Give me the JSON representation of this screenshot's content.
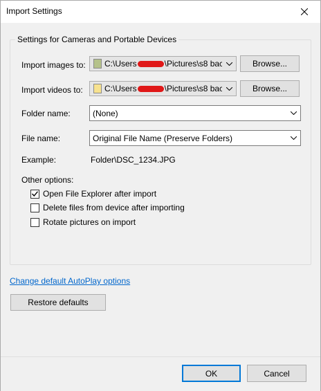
{
  "window": {
    "title": "Import Settings"
  },
  "group": {
    "legend": "Settings for Cameras and Portable Devices"
  },
  "import_images": {
    "label": "Import images to:",
    "path_prefix": "C:\\Users",
    "path_suffix": "\\Pictures\\s8 bac",
    "browse_label": "Browse...",
    "folder_color": "#b5c28a"
  },
  "import_videos": {
    "label": "Import videos to:",
    "path_prefix": "C:\\Users",
    "path_suffix": "\\Pictures\\s8 bac",
    "browse_label": "Browse...",
    "folder_color": "#f7e28f"
  },
  "folder_name": {
    "label": "Folder name:",
    "value": "(None)"
  },
  "file_name": {
    "label": "File name:",
    "value": "Original File Name (Preserve Folders)"
  },
  "example": {
    "label": "Example:",
    "value": "Folder\\DSC_1234.JPG"
  },
  "other_options": {
    "label": "Other options:",
    "items": [
      {
        "label": "Open File Explorer after import",
        "checked": true
      },
      {
        "label": "Delete files from device after importing",
        "checked": false
      },
      {
        "label": "Rotate pictures on import",
        "checked": false
      }
    ]
  },
  "autoplay_link": "Change default AutoPlay options",
  "restore_label": "Restore defaults",
  "ok_label": "OK",
  "cancel_label": "Cancel",
  "colors": {
    "accent": "#0078d7",
    "link": "#0066cc",
    "redaction": "#e01818"
  }
}
